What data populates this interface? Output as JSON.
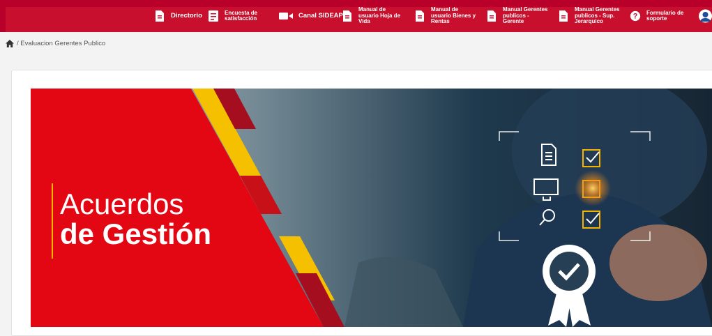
{
  "nav": {
    "items": [
      {
        "label": "Directorio",
        "icon": "document-icon"
      },
      {
        "label": "Encuesta de\nsatisfacción",
        "icon": "survey-icon"
      },
      {
        "label": "Canal SIDEAP",
        "icon": "video-icon"
      },
      {
        "label": "Manual de\nusuario Hoja de\nVida",
        "icon": "document-icon"
      },
      {
        "label": "Manual de\nusuario Bienes y\nRentas",
        "icon": "document-icon"
      },
      {
        "label": "Manual Gerentes\npublicos -\nGerente",
        "icon": "document-icon"
      },
      {
        "label": "Manual Gerentes\npublicos - Sup.\nJerarquico",
        "icon": "document-icon"
      },
      {
        "label": "Formulario de\nsoporte",
        "icon": "question-icon"
      }
    ]
  },
  "breadcrumb": {
    "text": "/ Evaluacion Gerentes Publico",
    "icon": "home-icon"
  },
  "banner": {
    "title_line1": "Acuerdos",
    "title_line2": "de Gestión"
  },
  "colors": {
    "brand_red": "#c8102e",
    "accent_yellow": "#f5b400",
    "dark_red": "#a50e1e"
  }
}
